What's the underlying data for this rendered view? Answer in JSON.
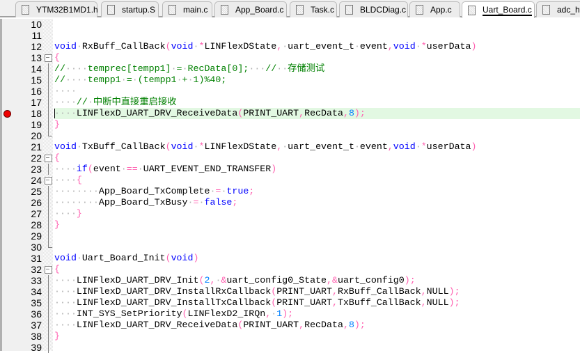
{
  "tabs": [
    {
      "label": "YTM32B1MD1.h",
      "active": false
    },
    {
      "label": "startup.S",
      "active": false
    },
    {
      "label": "main.c",
      "active": false
    },
    {
      "label": "App_Board.c",
      "active": false
    },
    {
      "label": "Task.c",
      "active": false
    },
    {
      "label": "BLDCDiag.c",
      "active": false
    },
    {
      "label": "App.c",
      "active": false
    },
    {
      "label": "Uart_Board.c",
      "active": true
    },
    {
      "label": "adc_hw",
      "active": false
    }
  ],
  "editor": {
    "breakpoint_line": 18,
    "current_line": 18,
    "lines": [
      {
        "n": "10",
        "fold": "",
        "tokens": []
      },
      {
        "n": "11",
        "fold": "",
        "tokens": []
      },
      {
        "n": "12",
        "fold": "",
        "tokens": [
          [
            "k",
            "void"
          ],
          [
            "t",
            " RxBuff_CallBack"
          ],
          [
            "p",
            "("
          ],
          [
            "k",
            "void"
          ],
          [
            "t",
            " "
          ],
          [
            "p",
            "*"
          ],
          [
            "t",
            "LINFlexDState"
          ],
          [
            "p",
            ","
          ],
          [
            "t",
            " uart_event_t event"
          ],
          [
            "p",
            ","
          ],
          [
            "k",
            "void"
          ],
          [
            "t",
            " "
          ],
          [
            "p",
            "*"
          ],
          [
            "t",
            "userData"
          ],
          [
            "p",
            ")"
          ]
        ]
      },
      {
        "n": "13",
        "fold": "box",
        "tokens": [
          [
            "p",
            "{"
          ]
        ]
      },
      {
        "n": "14",
        "fold": "line",
        "tokens": [
          [
            "c",
            "//    temprec[tempp1] = RecData[0];   //  存储测试"
          ]
        ]
      },
      {
        "n": "15",
        "fold": "line",
        "tokens": [
          [
            "c",
            "//    tempp1 = (tempp1 + 1)%40;"
          ]
        ]
      },
      {
        "n": "16",
        "fold": "line",
        "tokens": [
          [
            "t",
            "    "
          ]
        ]
      },
      {
        "n": "17",
        "fold": "line",
        "tokens": [
          [
            "t",
            "    "
          ],
          [
            "c",
            "// 中断中直接重启接收"
          ]
        ]
      },
      {
        "n": "18",
        "fold": "line",
        "tokens": [
          [
            "t",
            "    LINFlexD_UART_DRV_ReceiveData"
          ],
          [
            "p",
            "("
          ],
          [
            "t",
            "PRINT_UART"
          ],
          [
            "p",
            ","
          ],
          [
            "t",
            "RecData"
          ],
          [
            "p",
            ","
          ],
          [
            "n",
            "8"
          ],
          [
            "p",
            ")"
          ],
          [
            "p",
            ";"
          ]
        ]
      },
      {
        "n": "19",
        "fold": "line",
        "tokens": [
          [
            "p",
            "}"
          ]
        ]
      },
      {
        "n": "20",
        "fold": "end",
        "tokens": []
      },
      {
        "n": "21",
        "fold": "",
        "tokens": [
          [
            "k",
            "void"
          ],
          [
            "t",
            " TxBuff_CallBack"
          ],
          [
            "p",
            "("
          ],
          [
            "k",
            "void"
          ],
          [
            "t",
            " "
          ],
          [
            "p",
            "*"
          ],
          [
            "t",
            "LINFlexDState"
          ],
          [
            "p",
            ","
          ],
          [
            "t",
            " uart_event_t event"
          ],
          [
            "p",
            ","
          ],
          [
            "k",
            "void"
          ],
          [
            "t",
            " "
          ],
          [
            "p",
            "*"
          ],
          [
            "t",
            "userData"
          ],
          [
            "p",
            ")"
          ]
        ]
      },
      {
        "n": "22",
        "fold": "box",
        "tokens": [
          [
            "p",
            "{"
          ]
        ]
      },
      {
        "n": "23",
        "fold": "line",
        "tokens": [
          [
            "t",
            "    "
          ],
          [
            "k",
            "if"
          ],
          [
            "p",
            "("
          ],
          [
            "t",
            "event "
          ],
          [
            "p",
            "=="
          ],
          [
            "t",
            " UART_EVENT_END_TRANSFER"
          ],
          [
            "p",
            ")"
          ]
        ]
      },
      {
        "n": "24",
        "fold": "box",
        "tokens": [
          [
            "t",
            "    "
          ],
          [
            "p",
            "{"
          ]
        ]
      },
      {
        "n": "25",
        "fold": "line",
        "tokens": [
          [
            "t",
            "        App_Board_TxComplete "
          ],
          [
            "p",
            "="
          ],
          [
            "t",
            " "
          ],
          [
            "k",
            "true"
          ],
          [
            "p",
            ";"
          ]
        ]
      },
      {
        "n": "26",
        "fold": "line",
        "tokens": [
          [
            "t",
            "        App_Board_TxBusy "
          ],
          [
            "p",
            "="
          ],
          [
            "t",
            " "
          ],
          [
            "k",
            "false"
          ],
          [
            "p",
            ";"
          ]
        ]
      },
      {
        "n": "27",
        "fold": "line",
        "tokens": [
          [
            "t",
            "    "
          ],
          [
            "p",
            "}"
          ]
        ]
      },
      {
        "n": "28",
        "fold": "line",
        "tokens": [
          [
            "p",
            "}"
          ]
        ]
      },
      {
        "n": "29",
        "fold": "line",
        "tokens": []
      },
      {
        "n": "30",
        "fold": "end",
        "tokens": []
      },
      {
        "n": "31",
        "fold": "",
        "tokens": [
          [
            "k",
            "void"
          ],
          [
            "t",
            " Uart_Board_Init"
          ],
          [
            "p",
            "("
          ],
          [
            "k",
            "void"
          ],
          [
            "p",
            ")"
          ]
        ]
      },
      {
        "n": "32",
        "fold": "box",
        "tokens": [
          [
            "p",
            "{"
          ]
        ]
      },
      {
        "n": "33",
        "fold": "line",
        "tokens": [
          [
            "t",
            "    LINFlexD_UART_DRV_Init"
          ],
          [
            "p",
            "("
          ],
          [
            "n",
            "2"
          ],
          [
            "p",
            ","
          ],
          [
            "t",
            " "
          ],
          [
            "p",
            "&"
          ],
          [
            "t",
            "uart_config0_State"
          ],
          [
            "p",
            ","
          ],
          [
            "p",
            "&"
          ],
          [
            "t",
            "uart_config0"
          ],
          [
            "p",
            ")"
          ],
          [
            "p",
            ";"
          ]
        ]
      },
      {
        "n": "34",
        "fold": "line",
        "tokens": [
          [
            "t",
            "    LINFlexD_UART_DRV_InstallRxCallback"
          ],
          [
            "p",
            "("
          ],
          [
            "t",
            "PRINT_UART"
          ],
          [
            "p",
            ","
          ],
          [
            "t",
            "RxBuff_CallBack"
          ],
          [
            "p",
            ","
          ],
          [
            "t",
            "NULL"
          ],
          [
            "p",
            ")"
          ],
          [
            "p",
            ";"
          ]
        ]
      },
      {
        "n": "35",
        "fold": "line",
        "tokens": [
          [
            "t",
            "    LINFlexD_UART_DRV_InstallTxCallback"
          ],
          [
            "p",
            "("
          ],
          [
            "t",
            "PRINT_UART"
          ],
          [
            "p",
            ","
          ],
          [
            "t",
            "TxBuff_CallBack"
          ],
          [
            "p",
            ","
          ],
          [
            "t",
            "NULL"
          ],
          [
            "p",
            ")"
          ],
          [
            "p",
            ";"
          ]
        ]
      },
      {
        "n": "36",
        "fold": "line",
        "tokens": [
          [
            "t",
            "    INT_SYS_SetPriority"
          ],
          [
            "p",
            "("
          ],
          [
            "t",
            "LINFlexD2_IRQn"
          ],
          [
            "p",
            ","
          ],
          [
            "t",
            " "
          ],
          [
            "n",
            "1"
          ],
          [
            "p",
            ")"
          ],
          [
            "p",
            ";"
          ]
        ]
      },
      {
        "n": "37",
        "fold": "line",
        "tokens": [
          [
            "t",
            "    LINFlexD_UART_DRV_ReceiveData"
          ],
          [
            "p",
            "("
          ],
          [
            "t",
            "PRINT_UART"
          ],
          [
            "p",
            ","
          ],
          [
            "t",
            "RecData"
          ],
          [
            "p",
            ","
          ],
          [
            "n",
            "8"
          ],
          [
            "p",
            ")"
          ],
          [
            "p",
            ";"
          ]
        ]
      },
      {
        "n": "38",
        "fold": "line",
        "tokens": [
          [
            "p",
            "}"
          ]
        ]
      },
      {
        "n": "39",
        "fold": "line",
        "tokens": []
      }
    ]
  }
}
